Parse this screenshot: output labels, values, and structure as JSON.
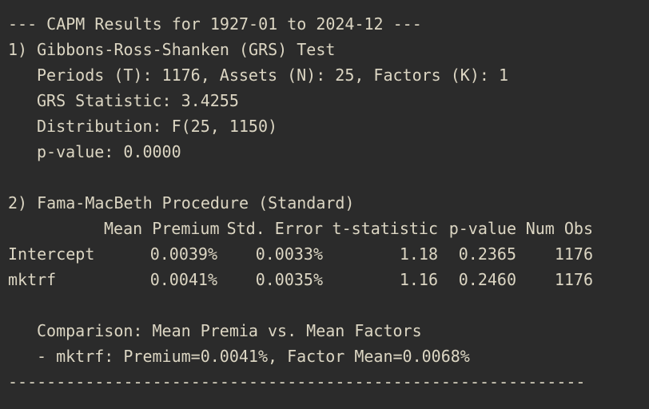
{
  "header": "--- CAPM Results for 1927-01 to 2024-12 ---",
  "grs": {
    "title": "1) Gibbons-Ross-Shanken (GRS) Test",
    "periods": "Periods (T): 1176, Assets (N): 25, Factors (K): 1",
    "statistic": "GRS Statistic: 3.4255",
    "distribution": "Distribution: F(25, 1150)",
    "pvalue": "p-value: 0.0000"
  },
  "fm": {
    "title": "2) Fama-MacBeth Procedure (Standard)",
    "columns": [
      "",
      "Mean Premium",
      "Std. Error",
      "t-statistic",
      "p-value",
      "Num Obs"
    ],
    "rows": [
      [
        "Intercept",
        "0.0039%",
        "0.0033%",
        "1.18",
        "0.2365",
        "1176"
      ],
      [
        "mktrf",
        "0.0041%",
        "0.0035%",
        "1.16",
        "0.2460",
        "1176"
      ]
    ]
  },
  "comparison": {
    "title": "Comparison: Mean Premia vs. Mean Factors",
    "item": "- mktrf: Premium=0.0041%, Factor Mean=0.0068%"
  },
  "rule": "------------------------------------------------------------"
}
